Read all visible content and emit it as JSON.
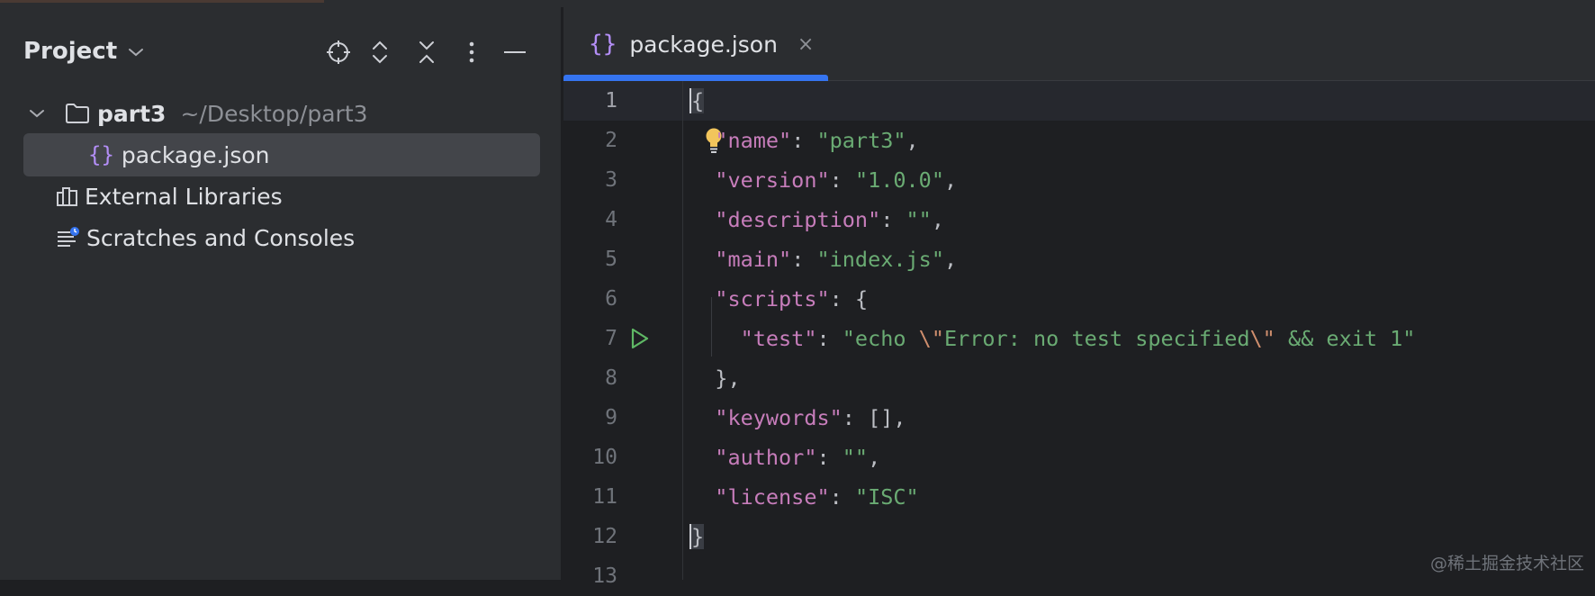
{
  "project_panel": {
    "title": "Project",
    "tree": [
      {
        "name": "part3",
        "hint": "~/Desktop/part3"
      },
      {
        "name": "package.json"
      },
      {
        "name": "External Libraries"
      },
      {
        "name": "Scratches and Consoles"
      }
    ]
  },
  "editor": {
    "tab": {
      "label": "package.json",
      "icon": "{}",
      "close": "×"
    },
    "line_numbers": [
      "1",
      "2",
      "3",
      "4",
      "5",
      "6",
      "7",
      "8",
      "9",
      "10",
      "11",
      "12",
      "13"
    ],
    "lines": {
      "l1": {
        "brace": "{"
      },
      "l2": {
        "key": "\"name\"",
        "colon": ": ",
        "value": "\"part3\"",
        "comma": ","
      },
      "l3": {
        "key": "\"version\"",
        "colon": ": ",
        "value": "\"1.0.0\"",
        "comma": ","
      },
      "l4": {
        "key": "\"description\"",
        "colon": ": ",
        "value": "\"\"",
        "comma": ","
      },
      "l5": {
        "key": "\"main\"",
        "colon": ": ",
        "value": "\"index.js\"",
        "comma": ","
      },
      "l6": {
        "key": "\"scripts\"",
        "colon": ": ",
        "open": "{"
      },
      "l7": {
        "key": "\"test\"",
        "colon": ": ",
        "v1": "\"echo ",
        "esc1": "\\\"",
        "v2": "Error: no test specified",
        "esc2": "\\\"",
        "v3": " && exit 1\""
      },
      "l8": {
        "close": "},"
      },
      "l9": {
        "key": "\"keywords\"",
        "colon": ": ",
        "value": "[]",
        "comma": ","
      },
      "l10": {
        "key": "\"author\"",
        "colon": ": ",
        "value": "\"\"",
        "comma": ","
      },
      "l11": {
        "key": "\"license\"",
        "colon": ": ",
        "value": "\"ISC\""
      },
      "l12": {
        "brace": "}"
      }
    }
  },
  "watermark": "@稀土掘金技术社区",
  "colors": {
    "accent": "#3574f0",
    "json_key": "#c77dbb",
    "json_string": "#6aab73",
    "escape": "#cf8e6d",
    "run_icon": "#5fb865",
    "bulb": "#f2c55c"
  }
}
